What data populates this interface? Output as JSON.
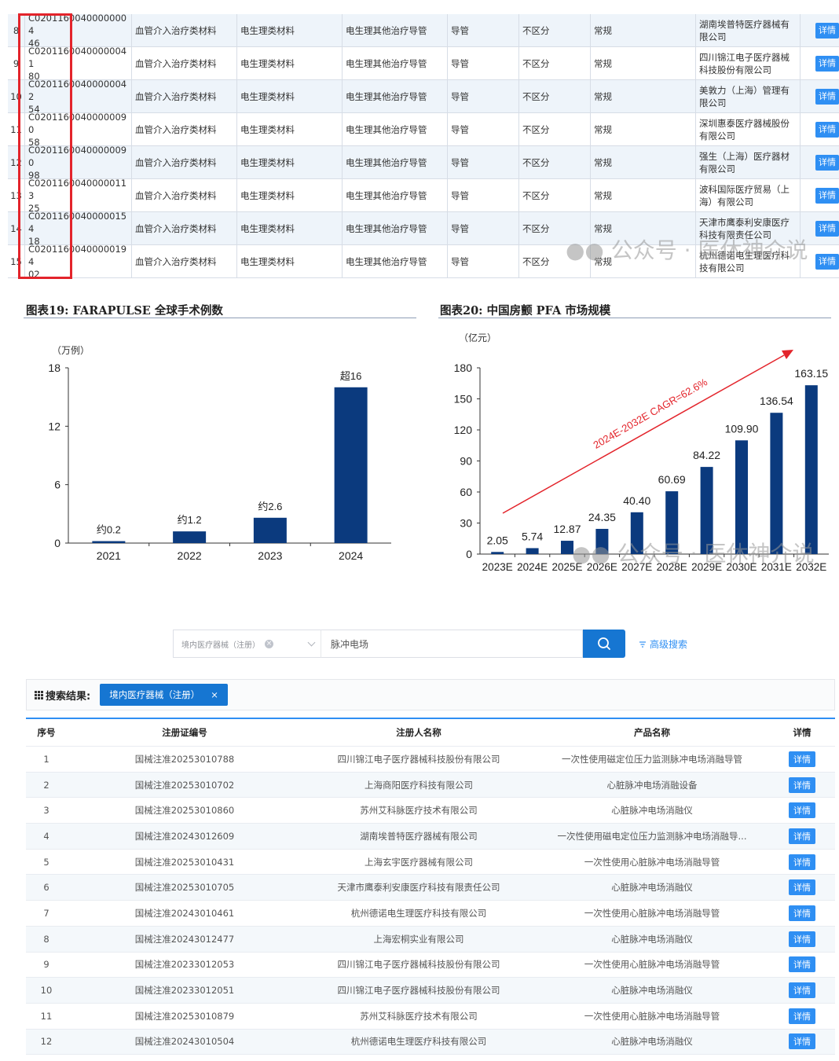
{
  "top_table": {
    "rows": [
      {
        "idx": "8",
        "code_a": "C02011600400000004",
        "code_b": "46",
        "cat1": "血管介入治疗类材料",
        "cat2": "电生理类材料",
        "cat3": "电生理其他治疗导管",
        "type": "导管",
        "split": "不区分",
        "norm": "常规",
        "company": "湖南埃普特医疗器械有限公司",
        "detail": "详情"
      },
      {
        "idx": "9",
        "code_a": "C02011600400000041",
        "code_b": "80",
        "cat1": "血管介入治疗类材料",
        "cat2": "电生理类材料",
        "cat3": "电生理其他治疗导管",
        "type": "导管",
        "split": "不区分",
        "norm": "常规",
        "company": "四川锦江电子医疗器械科技股份有限公司",
        "detail": "详情"
      },
      {
        "idx": "10",
        "code_a": "C02011600400000042",
        "code_b": "54",
        "cat1": "血管介入治疗类材料",
        "cat2": "电生理类材料",
        "cat3": "电生理其他治疗导管",
        "type": "导管",
        "split": "不区分",
        "norm": "常规",
        "company": "美敦力（上海）管理有限公司",
        "detail": "详情"
      },
      {
        "idx": "11",
        "code_a": "C02011600400000090",
        "code_b": "58",
        "cat1": "血管介入治疗类材料",
        "cat2": "电生理类材料",
        "cat3": "电生理其他治疗导管",
        "type": "导管",
        "split": "不区分",
        "norm": "常规",
        "company": "深圳惠泰医疗器械股份有限公司",
        "detail": "详情"
      },
      {
        "idx": "12",
        "code_a": "C02011600400000090",
        "code_b": "98",
        "cat1": "血管介入治疗类材料",
        "cat2": "电生理类材料",
        "cat3": "电生理其他治疗导管",
        "type": "导管",
        "split": "不区分",
        "norm": "常规",
        "company": "强生（上海）医疗器材有限公司",
        "detail": "详情"
      },
      {
        "idx": "13",
        "code_a": "C02011600400000113",
        "code_b": "25",
        "cat1": "血管介入治疗类材料",
        "cat2": "电生理类材料",
        "cat3": "电生理其他治疗导管",
        "type": "导管",
        "split": "不区分",
        "norm": "常规",
        "company": "波科国际医疗贸易（上海）有限公司",
        "detail": "详情"
      },
      {
        "idx": "14",
        "code_a": "C02011600400000154",
        "code_b": "18",
        "cat1": "血管介入治疗类材料",
        "cat2": "电生理类材料",
        "cat3": "电生理其他治疗导管",
        "type": "导管",
        "split": "不区分",
        "norm": "常规",
        "company": "天津市鹰泰利安康医疗科技有限责任公司",
        "detail": "详情"
      },
      {
        "idx": "15",
        "code_a": "C02011600400000194",
        "code_b": "02",
        "cat1": "血管介入治疗类材料",
        "cat2": "电生理类材料",
        "cat3": "电生理其他治疗导管",
        "type": "导管",
        "split": "不区分",
        "norm": "常规",
        "company": "杭州德诺电生理医疗科技有限公司",
        "detail": "详情"
      }
    ]
  },
  "watermark_text": "公众号 · 医休神介说",
  "chart_data": [
    {
      "type": "bar",
      "title": "图表19:  FARAPULSE 全球手术例数",
      "ylabel": "（万例）",
      "categories": [
        "2021",
        "2022",
        "2023",
        "2024"
      ],
      "values": [
        0.2,
        1.2,
        2.6,
        16
      ],
      "data_labels": [
        "约0.2",
        "约1.2",
        "约2.6",
        "超16"
      ],
      "yticks": [
        "0",
        "6",
        "12",
        "18"
      ],
      "ylim": [
        0,
        18
      ],
      "color": "#0b3a7e",
      "grid": false
    },
    {
      "type": "bar",
      "title": "图表20:   中国房颤 PFA 市场规模",
      "ylabel": "（亿元）",
      "categories": [
        "2023E",
        "2024E",
        "2025E",
        "2026E",
        "2027E",
        "2028E",
        "2029E",
        "2030E",
        "2031E",
        "2032E"
      ],
      "values": [
        2.05,
        5.74,
        12.87,
        24.35,
        40.4,
        60.69,
        84.22,
        109.9,
        136.54,
        163.15
      ],
      "data_labels": [
        "2.05",
        "5.74",
        "12.87",
        "24.35",
        "40.40",
        "60.69",
        "84.22",
        "109.90",
        "136.54",
        "163.15"
      ],
      "yticks": [
        "0",
        "30",
        "60",
        "90",
        "120",
        "150",
        "180"
      ],
      "ylim": [
        0,
        180
      ],
      "color": "#0b3a7e",
      "annotation": "2024E-2032E CAGR=62.6%",
      "annotation_color": "#e3242b",
      "grid": false
    }
  ],
  "search": {
    "select_value": "境内医疗器械（注册）",
    "clear_glyph": "×",
    "query": "脉冲电场",
    "advanced_label": "高级搜索"
  },
  "results": {
    "label": "搜索结果:",
    "tag": "境内医疗器械（注册）",
    "tag_close": "×",
    "headers": {
      "idx": "序号",
      "no": "注册证编号",
      "reg": "注册人名称",
      "prod": "产品名称",
      "det": "详情"
    },
    "rows": [
      {
        "idx": "1",
        "no": "国械注准20253010788",
        "reg": "四川锦江电子医疗器械科技股份有限公司",
        "prod": "一次性使用磁定位压力监测脉冲电场消融导管",
        "det": "详情"
      },
      {
        "idx": "2",
        "no": "国械注准20253010702",
        "reg": "上海商阳医疗科技有限公司",
        "prod": "心脏脉冲电场消融设备",
        "det": "详情"
      },
      {
        "idx": "3",
        "no": "国械注准20253010860",
        "reg": "苏州艾科脉医疗技术有限公司",
        "prod": "心脏脉冲电场消融仪",
        "det": "详情"
      },
      {
        "idx": "4",
        "no": "国械注准20243012609",
        "reg": "湖南埃普特医疗器械有限公司",
        "prod": "一次性使用磁电定位压力监测脉冲电场消融导...",
        "det": "详情"
      },
      {
        "idx": "5",
        "no": "国械注准20253010431",
        "reg": "上海玄宇医疗器械有限公司",
        "prod": "一次性使用心脏脉冲电场消融导管",
        "det": "详情"
      },
      {
        "idx": "6",
        "no": "国械注准20253010705",
        "reg": "天津市鹰泰利安康医疗科技有限责任公司",
        "prod": "心脏脉冲电场消融仪",
        "det": "详情"
      },
      {
        "idx": "7",
        "no": "国械注准20243010461",
        "reg": "杭州德诺电生理医疗科技有限公司",
        "prod": "一次性使用心脏脉冲电场消融导管",
        "det": "详情"
      },
      {
        "idx": "8",
        "no": "国械注准20243012477",
        "reg": "上海宏桐实业有限公司",
        "prod": "心脏脉冲电场消融仪",
        "det": "详情"
      },
      {
        "idx": "9",
        "no": "国械注准20233012053",
        "reg": "四川锦江电子医疗器械科技股份有限公司",
        "prod": "一次性使用心脏脉冲电场消融导管",
        "det": "详情"
      },
      {
        "idx": "10",
        "no": "国械注准20233012051",
        "reg": "四川锦江电子医疗器械科技股份有限公司",
        "prod": "心脏脉冲电场消融仪",
        "det": "详情"
      },
      {
        "idx": "11",
        "no": "国械注准20253010879",
        "reg": "苏州艾科脉医疗技术有限公司",
        "prod": "一次性使用心脏脉冲电场消融导管",
        "det": "详情"
      },
      {
        "idx": "12",
        "no": "国械注准20243010504",
        "reg": "杭州德诺电生理医疗科技有限公司",
        "prod": "心脏脉冲电场消融仪",
        "det": "详情"
      }
    ]
  }
}
